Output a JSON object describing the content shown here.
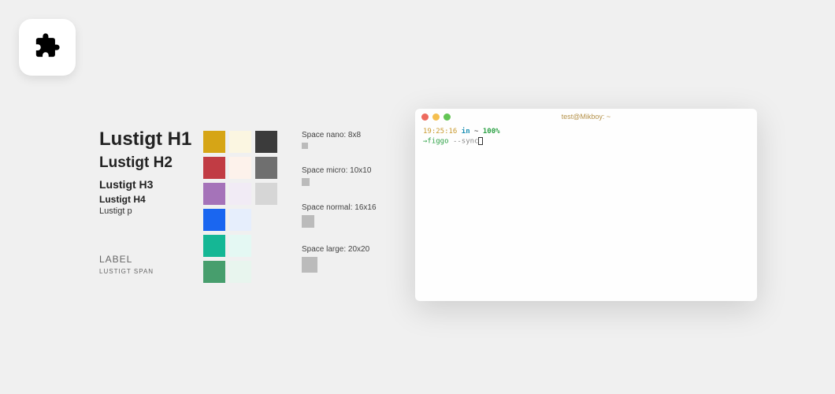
{
  "typography": {
    "h1": "Lustigt H1",
    "h2": "Lustigt H2",
    "h3": "Lustigt H3",
    "h4": "Lustigt H4",
    "p": "Lustigt p",
    "label": "LABEL",
    "span": "LUSTIGT SPAN"
  },
  "swatches": [
    [
      "#d6a516",
      "#fbf6e1",
      "#3b3b3b"
    ],
    [
      "#c13c44",
      "#fdf2eb",
      "#6f6f6f"
    ],
    [
      "#a573b9",
      "#f1ebf5",
      "#d6d6d6"
    ],
    [
      "#1a66f0",
      "#e6eefc",
      ""
    ],
    [
      "#15b795",
      "#e4f8f3",
      ""
    ],
    [
      "#479e6d",
      "#e8f5ee",
      ""
    ]
  ],
  "spacing": {
    "nano": "Space nano: 8x8",
    "micro": "Space micro: 10x10",
    "normal": "Space normal: 16x16",
    "large": "Space large: 20x20"
  },
  "terminal": {
    "title": "test@Mikboy: ~",
    "time": "19:25:16",
    "in": "in",
    "tilde": "~",
    "percent": "100%",
    "arrow": "→",
    "cmd": "figgo",
    "flag": "--sync"
  }
}
